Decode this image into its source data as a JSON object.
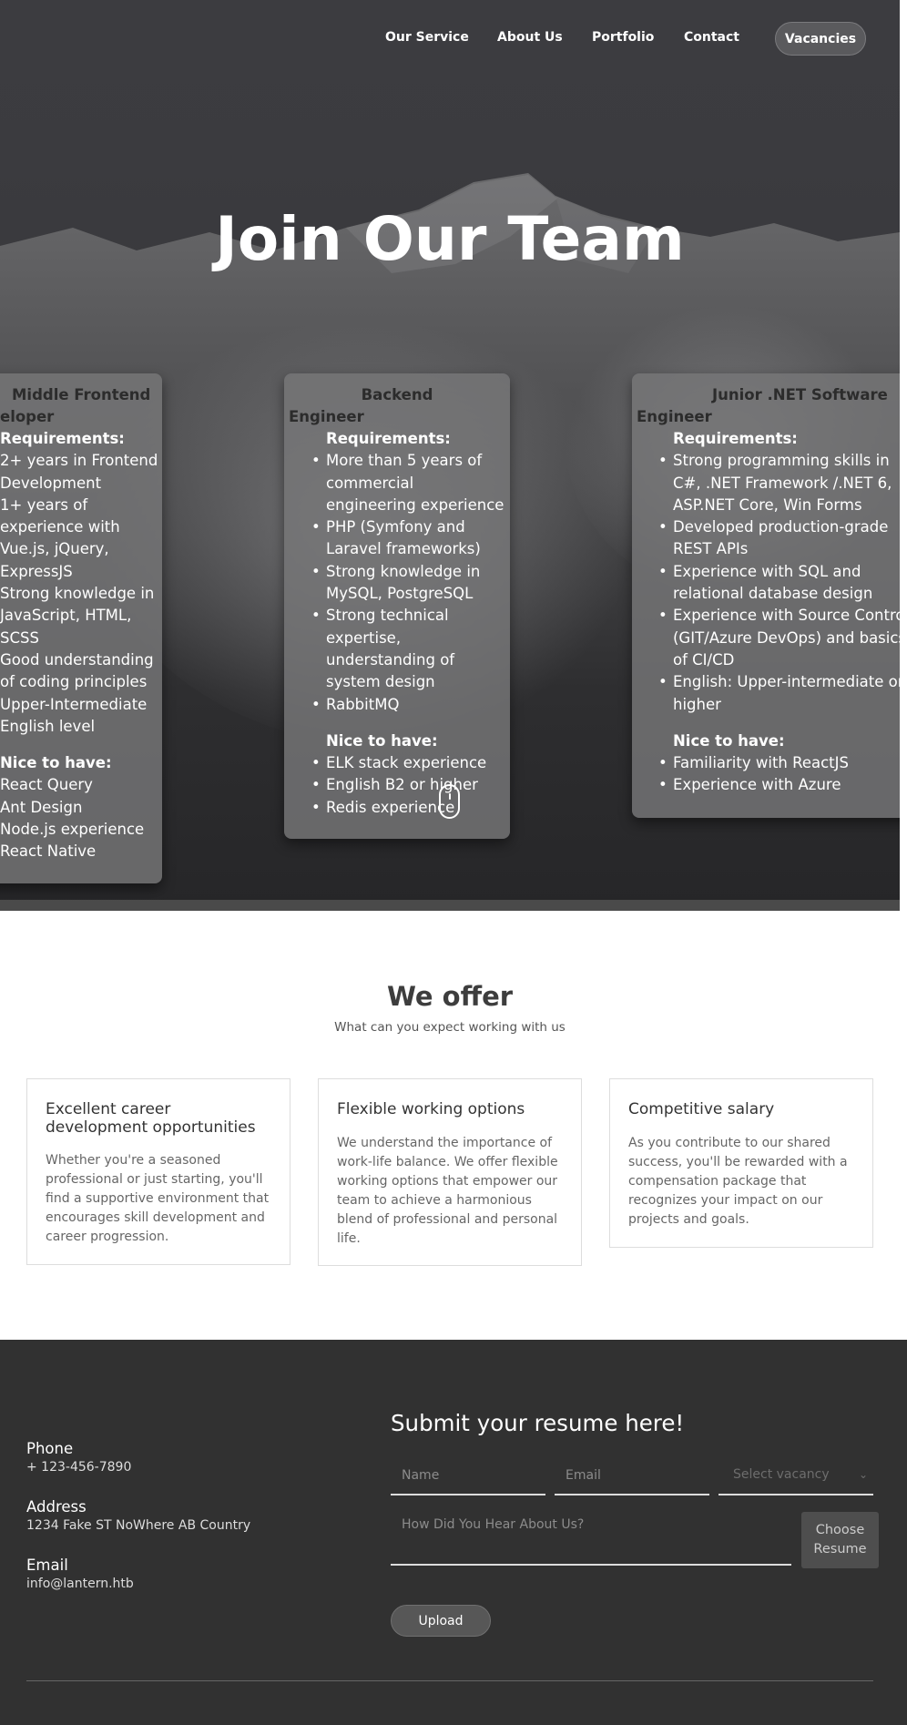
{
  "nav": {
    "links": [
      "Our Service",
      "About Us",
      "Portfolio",
      "Contact"
    ],
    "vacancies_label": "Vacancies"
  },
  "hero": {
    "title": "Join Our Team"
  },
  "vacancies": [
    {
      "title_line1": "Middle Frontend",
      "title_line2": "eloper",
      "requirements_label": "Requirements:",
      "requirements": [
        "2+ years in Frontend",
        "Development",
        "1+ years of",
        "experience with",
        "Vue.js, jQuery,",
        "ExpressJS",
        "Strong knowledge in",
        "JavaScript, HTML,",
        "SCSS",
        "Good understanding",
        "of coding principles",
        "Upper-Intermediate",
        "English level"
      ],
      "nice_label": "Nice to have:",
      "nice": [
        "React Query",
        "Ant Design",
        "Node.js experience",
        "React Native"
      ]
    },
    {
      "title_line1": "Backend",
      "title_line2": "Engineer",
      "requirements_label": "Requirements:",
      "requirements": [
        "More than 5 years of commercial engineering experience",
        "PHP (Symfony and Laravel frameworks)",
        "Strong knowledge in MySQL, PostgreSQL",
        "Strong technical expertise, understanding of system design",
        "RabbitMQ"
      ],
      "nice_label": "Nice to have:",
      "nice": [
        "ELK stack experience",
        "English B2 or higher",
        "Redis experience"
      ]
    },
    {
      "title_line1": "Junior .NET Software",
      "title_line2": "Engineer",
      "requirements_label": "Requirements:",
      "requirements": [
        "Strong programming skills in C#, .NET Framework /.NET 6, ASP.NET Core, Win Forms",
        "Developed production-grade REST APIs",
        "Experience with SQL and relational database design",
        "Experience with Source Control (GIT/Azure DevOps) and basics of CI/CD",
        "English: Upper-intermediate or higher"
      ],
      "nice_label": "Nice to have:",
      "nice": [
        "Familiarity with ReactJS",
        "Experience with Azure"
      ]
    }
  ],
  "offer": {
    "title": "We offer",
    "subtitle": "What can you expect working with us",
    "cards": [
      {
        "title": "Excellent career development opportunities",
        "text": "Whether you're a seasoned professional or just starting, you'll find a supportive environment that encourages skill development and career progression."
      },
      {
        "title": "Flexible working options",
        "text": "We understand the importance of work-life balance. We offer flexible working options that empower our team to achieve a harmonious blend of professional and personal life."
      },
      {
        "title": "Competitive salary",
        "text": "As you contribute to our shared success, you'll be rewarded with a compensation package that recognizes your impact on our projects and goals."
      }
    ]
  },
  "contact": {
    "phone_label": "Phone",
    "phone": "+ 123-456-7890",
    "address_label": "Address",
    "address": "1234 Fake ST NoWhere AB Country",
    "email_label": "Email",
    "email": "info@lantern.htb"
  },
  "form": {
    "title": "Submit your resume here!",
    "name_placeholder": "Name",
    "email_placeholder": "Email",
    "vacancy_placeholder": "Select vacancy",
    "source_placeholder": "How Did You Hear About Us?",
    "choose_label": "Choose Resume",
    "upload_label": "Upload"
  },
  "icons": {
    "scroll": "mouse-scroll-icon",
    "select": "chevron-down-icon"
  },
  "colors": {
    "dark_bg": "#313131",
    "card_bg": "#767678",
    "text_dark": "#3d3d3d"
  }
}
